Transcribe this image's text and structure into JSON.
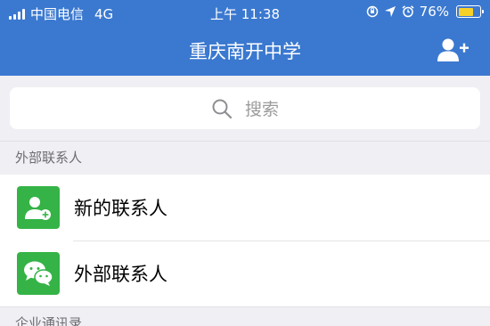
{
  "status_bar": {
    "carrier": "中国电信",
    "network": "4G",
    "time": "上午 11:38",
    "battery_percent": "76%",
    "battery_level": 0.76,
    "icons": [
      "signal-icon",
      "orientation-lock-icon",
      "location-icon",
      "alarm-icon",
      "battery-icon"
    ]
  },
  "nav": {
    "title": "重庆南开中学",
    "right_icon": "add-contact-icon"
  },
  "search": {
    "placeholder": "搜索",
    "icon": "search-icon"
  },
  "sections": [
    {
      "header": "外部联系人",
      "items": [
        {
          "label": "新的联系人",
          "icon": "new-contact-icon"
        },
        {
          "label": "外部联系人",
          "icon": "wechat-icon"
        }
      ]
    },
    {
      "header": "企业通讯录"
    }
  ],
  "colors": {
    "header_blue": "#3b79d0",
    "icon_green": "#35b346",
    "background": "#efeff4",
    "battery_yellow": "#f7d02a"
  }
}
